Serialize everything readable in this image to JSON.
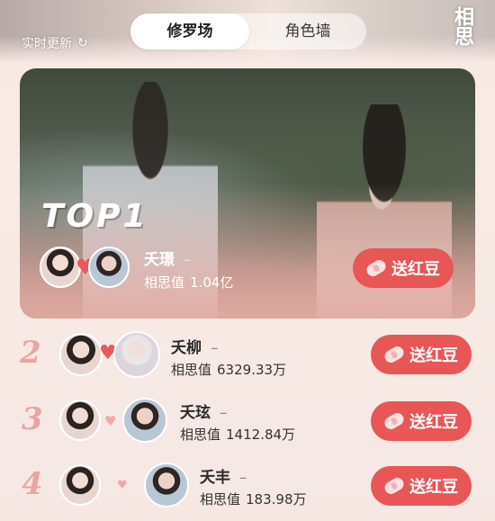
{
  "header": {
    "status_text": "实时更新",
    "refresh_icon": "refresh-icon",
    "seal_text": "相思"
  },
  "tabs": [
    {
      "label": "修罗场",
      "active": true
    },
    {
      "label": "角色墙",
      "active": false
    }
  ],
  "ranking": {
    "score_label": "相思值",
    "gift_label": "送红豆",
    "top": {
      "badge": "TOP1",
      "name": "夭璟",
      "suffix": "–",
      "score": "1.04亿"
    },
    "items": [
      {
        "rank": "2",
        "name": "夭柳",
        "suffix": "–",
        "score": "6329.33万"
      },
      {
        "rank": "3",
        "name": "夭玹",
        "suffix": "–",
        "score": "1412.84万"
      },
      {
        "rank": "4",
        "name": "夭丰",
        "suffix": "–",
        "score": "183.98万"
      }
    ]
  },
  "colors": {
    "accent": "#e85656",
    "rank_number": "#e7a6a1",
    "background": "#f8e9e4"
  }
}
